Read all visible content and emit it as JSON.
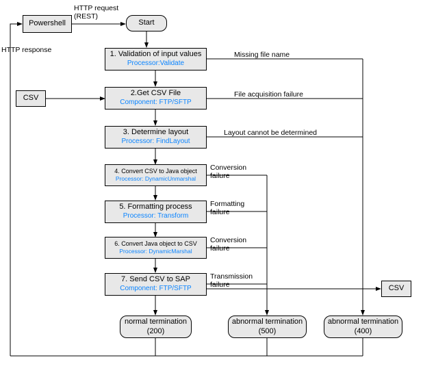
{
  "chart_data": {
    "type": "flowchart",
    "entry": "Powershell sends HTTP request (REST) to Start",
    "input": "CSV file via FTP/SFTP",
    "output_success": "CSV sent to SAP",
    "steps": [
      {
        "id": 1,
        "label": "Validation of input values",
        "impl": "Processor:Validate",
        "on_error": "Missing file name → abnormal termination (400)"
      },
      {
        "id": 2,
        "label": "Get CSV File",
        "impl": "Component: FTP/SFTP",
        "on_error": "File acquisition failure → abnormal termination (400)"
      },
      {
        "id": 3,
        "label": "Determine layout",
        "impl": "Processor: FindLayout",
        "on_error": "Layout cannot be determined → abnormal termination (400)"
      },
      {
        "id": 4,
        "label": "Convert CSV to Java object",
        "impl": "Processor: DynamicUnmarshal",
        "on_error": "Conversion failure → abnormal termination (500)"
      },
      {
        "id": 5,
        "label": "Formatting process",
        "impl": "Processor: Transform",
        "on_error": "Formatting failure → abnormal termination (500)"
      },
      {
        "id": 6,
        "label": "Convert Java object to CSV",
        "impl": "Processor: DynamicMarshal",
        "on_error": "Conversion failure → abnormal termination (500)"
      },
      {
        "id": 7,
        "label": "Send CSV to SAP",
        "impl": "Component: FTP/SFTP",
        "on_error": "Transmission failure → abnormal termination (500)"
      }
    ],
    "terminations": [
      {
        "label": "normal termination",
        "code": 200
      },
      {
        "label": "abnormal termination",
        "code": 500
      },
      {
        "label": "abnormal termination",
        "code": 400
      }
    ],
    "return": "HTTP response back to Powershell"
  },
  "labels": {
    "powershell": "Powershell",
    "start": "Start",
    "http_req": "HTTP request\n(REST)",
    "http_resp": "HTTP response",
    "csv_in": "CSV",
    "csv_out": "CSV",
    "err1": "Missing file name",
    "err2": "File acquisition failure",
    "err3": "Layout cannot be determined",
    "err4": "Conversion\nfailure",
    "err5": "Formatting\nfailure",
    "err6": "Conversion\nfailure",
    "err7": "Transmission\nfailure"
  },
  "nodes": {
    "s1": {
      "t": "1. Validation of input values",
      "s": "Processor:Validate"
    },
    "s2": {
      "t": "2.Get CSV File",
      "s": "Component: FTP/SFTP"
    },
    "s3": {
      "t": "3. Determine layout",
      "s": "Processor: FindLayout"
    },
    "s4": {
      "t": "4. Convert CSV to Java object",
      "s": "Processor: DynamicUnmarshal"
    },
    "s5": {
      "t": "5. Formatting process",
      "s": "Processor: Transform"
    },
    "s6": {
      "t": "6. Convert Java object to CSV",
      "s": "Processor: DynamicMarshal"
    },
    "s7": {
      "t": "7. Send CSV to SAP",
      "s": "Component: FTP/SFTP"
    },
    "t200": {
      "t": "normal termination",
      "s": "(200)"
    },
    "t500": {
      "t": "abnormal termination",
      "s": "(500)"
    },
    "t400": {
      "t": "abnormal termination",
      "s": "(400)"
    }
  }
}
